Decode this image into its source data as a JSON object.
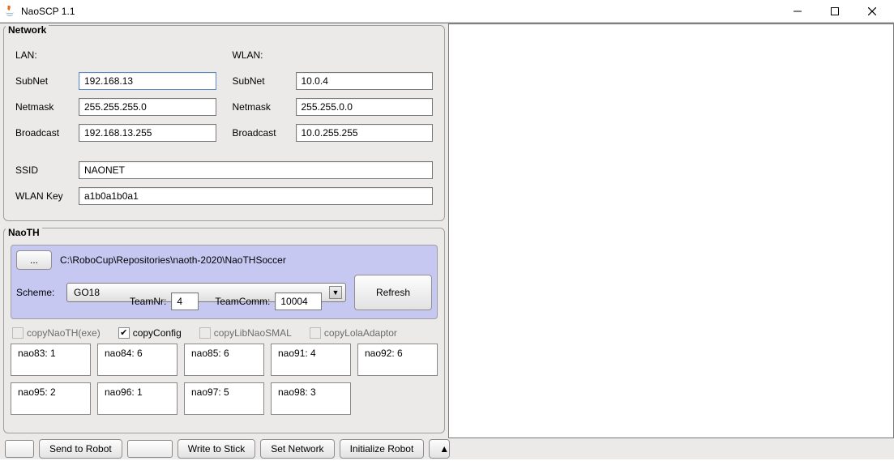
{
  "window": {
    "title": "NaoSCP 1.1"
  },
  "network": {
    "title": "Network",
    "lan_label": "LAN:",
    "wlan_label": "WLAN:",
    "subnet_label": "SubNet",
    "netmask_label": "Netmask",
    "broadcast_label": "Broadcast",
    "ssid_label": "SSID",
    "wlankey_label": "WLAN Key",
    "lan_subnet": "192.168.13",
    "lan_netmask": "255.255.255.0",
    "lan_broadcast": "192.168.13.255",
    "wlan_subnet": "10.0.4",
    "wlan_netmask": "255.255.0.0",
    "wlan_broadcast": "10.0.255.255",
    "ssid": "NAONET",
    "wlan_key": "a1b0a1b0a1"
  },
  "naoth": {
    "title": "NaoTH",
    "browse_label": "...",
    "path": "C:\\RoboCup\\Repositories\\naoth-2020\\NaoTHSoccer",
    "scheme_label": "Scheme:",
    "scheme_value": "GO18",
    "refresh_label": "Refresh",
    "teamnr_label": "TeamNr:",
    "teamnr_value": "4",
    "teamcomm_label": "TeamComm:",
    "teamcomm_value": "10004",
    "checks": {
      "copy_naoth": "copyNaoTH(exe)",
      "copy_config": "copyConfig",
      "copy_lib": "copyLibNaoSMAL",
      "copy_lola": "copyLolaAdaptor",
      "copy_config_checked": true
    },
    "robots": [
      "nao83: 1",
      "nao84: 6",
      "nao85: 6",
      "nao91: 4",
      "nao92: 6",
      "nao95: 2",
      "nao96: 1",
      "nao97: 5",
      "nao98: 3"
    ]
  },
  "bottom": {
    "send_to_robot": "Send to Robot",
    "write_to_stick": "Write to Stick",
    "set_network": "Set Network",
    "initialize_robot": "Initialize Robot",
    "tri": "▲"
  }
}
